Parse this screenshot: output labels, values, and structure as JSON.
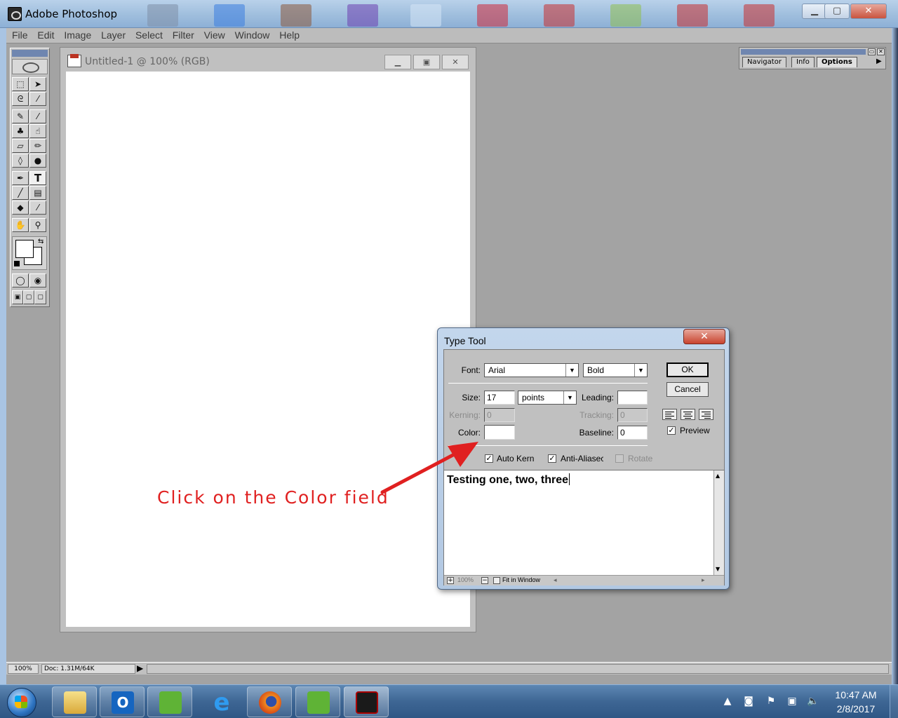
{
  "app": {
    "title": "Adobe Photoshop"
  },
  "menu": [
    "File",
    "Edit",
    "Image",
    "Layer",
    "Select",
    "Filter",
    "View",
    "Window",
    "Help"
  ],
  "document": {
    "title": "Untitled-1 @ 100% (RGB)"
  },
  "palette": {
    "tabs": [
      "Navigator",
      "Info",
      "Options"
    ],
    "active_tab": "Options"
  },
  "status": {
    "zoom": "100%",
    "doc_info": "Doc: 1.31M/64K"
  },
  "dialog": {
    "title": "Type Tool",
    "close_glyph": "✕",
    "font_label": "Font:",
    "font_value": "Arial",
    "style_value": "Bold",
    "size_label": "Size:",
    "size_value": "17",
    "units_value": "points",
    "leading_label": "Leading:",
    "leading_value": "",
    "kerning_label": "Kerning:",
    "kerning_value": "0",
    "tracking_label": "Tracking:",
    "tracking_value": "0",
    "color_label": "Color:",
    "baseline_label": "Baseline:",
    "baseline_value": "0",
    "ok_label": "OK",
    "cancel_label": "Cancel",
    "preview_label": "Preview",
    "preview_checked": true,
    "autokern_label": "Auto Kern",
    "autokern_checked": true,
    "antialiased_label": "Anti-Aliasec",
    "antialiased_checked": true,
    "rotate_label": "Rotate",
    "rotate_checked": false,
    "text": "Testing one, two, three",
    "footer_zoom": "100%",
    "footer_fit": "Fit in Window"
  },
  "annotation": {
    "text": "Click on the Color field",
    "color": "#e02020"
  },
  "taskbar": {
    "apps": [
      "file-explorer",
      "outlook",
      "green-app",
      "internet-explorer",
      "firefox",
      "green-app-2",
      "photoshop"
    ],
    "time": "10:47 AM",
    "date": "2/8/2017"
  },
  "colors": {
    "accent": "#e02020",
    "desktop": "#a3a3a3",
    "taskbar": "#3e6694"
  }
}
